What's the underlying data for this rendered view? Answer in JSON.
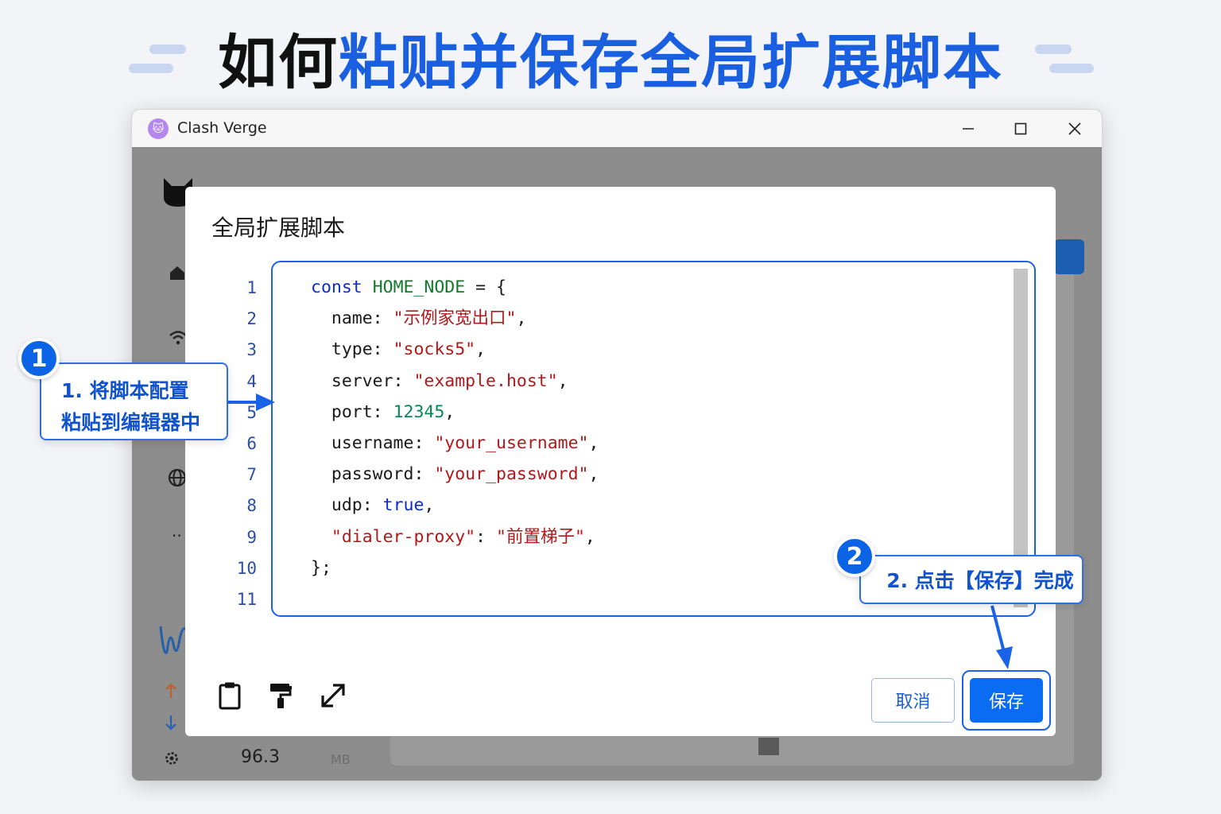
{
  "headline": {
    "dark_part": "如何",
    "blue_part": "粘贴并保存全局扩展脚本"
  },
  "window": {
    "app_title": "Clash Verge",
    "controls": [
      "minimize",
      "maximize",
      "close"
    ]
  },
  "background_app": {
    "memory_value": "96.3",
    "memory_unit": "MB"
  },
  "dialog": {
    "title": "全局扩展脚本",
    "line_numbers": [
      "1",
      "2",
      "3",
      "4",
      "5",
      "6",
      "7",
      "8",
      "9",
      "10",
      "11"
    ],
    "code": {
      "l1_kw": "const",
      "l1_name": "HOME_NODE",
      "l1_rest": " = {",
      "l2_key": "name: ",
      "l2_val": "\"示例家宽出口\"",
      "l3_key": "type: ",
      "l3_val": "\"socks5\"",
      "l4_key": "server: ",
      "l4_val": "\"example.host\"",
      "l5_key": "port: ",
      "l5_val": "12345",
      "l6_key": "username: ",
      "l6_val": "\"your_username\"",
      "l7_key": "password: ",
      "l7_val": "\"your_password\"",
      "l8_key": "udp: ",
      "l8_val": "true",
      "l9_key": "\"dialer-proxy\"",
      "l9_sep": ": ",
      "l9_val": "\"前置梯子\"",
      "l10": "};",
      "comma": ","
    },
    "toolbar_icons": [
      "clipboard-icon",
      "format-paint-icon",
      "expand-icon"
    ],
    "cancel_label": "取消",
    "save_label": "保存"
  },
  "callouts": {
    "step1_badge": "1",
    "step1_line1": "1. 将脚本配置",
    "step1_line2": "粘贴到编辑器中",
    "step2_badge": "2",
    "step2_text": "2. 点击【保存】完成"
  },
  "colors": {
    "accent_blue": "#1a62e8",
    "save_button": "#0a6cf2",
    "keyword": "#0b2bd0",
    "string": "#b3181b"
  }
}
